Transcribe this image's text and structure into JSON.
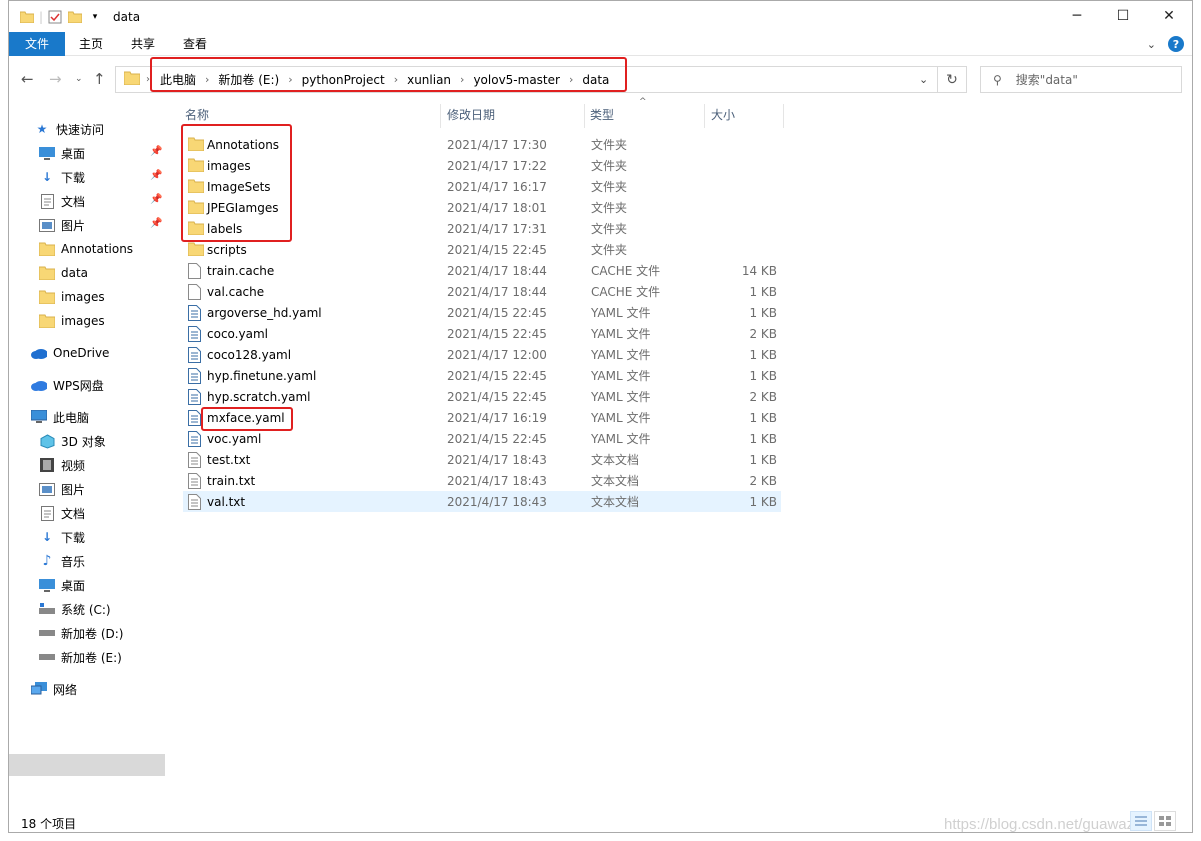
{
  "window": {
    "title": "data"
  },
  "ribbon": {
    "tabs": [
      "文件",
      "主页",
      "共享",
      "查看"
    ]
  },
  "address": {
    "crumbs": [
      "此电脑",
      "新加卷 (E:)",
      "pythonProject",
      "xunlian",
      "yolov5-master",
      "data"
    ]
  },
  "search": {
    "placeholder": "搜索\"data\""
  },
  "nav": {
    "quick_access": "快速访问",
    "pinned": [
      "桌面",
      "下载",
      "文档",
      "图片"
    ],
    "recent": [
      "Annotations",
      "data",
      "images",
      "images"
    ],
    "onedrive": "OneDrive",
    "wps": "WPS网盘",
    "this_pc": "此电脑",
    "pc_items": [
      "3D 对象",
      "视频",
      "图片",
      "文档",
      "下载",
      "音乐",
      "桌面",
      "系统 (C:)",
      "新加卷 (D:)",
      "新加卷 (E:)"
    ],
    "network": "网络"
  },
  "columns": {
    "name": "名称",
    "date": "修改日期",
    "type": "类型",
    "size": "大小"
  },
  "files": [
    {
      "name": "Annotations",
      "date": "2021/4/17 17:30",
      "type": "文件夹",
      "size": "",
      "icon": "folder-icon"
    },
    {
      "name": "images",
      "date": "2021/4/17 17:22",
      "type": "文件夹",
      "size": "",
      "icon": "folder-icon"
    },
    {
      "name": "ImageSets",
      "date": "2021/4/17 16:17",
      "type": "文件夹",
      "size": "",
      "icon": "folder-icon"
    },
    {
      "name": "JPEGIamges",
      "date": "2021/4/17 18:01",
      "type": "文件夹",
      "size": "",
      "icon": "folder-icon"
    },
    {
      "name": "labels",
      "date": "2021/4/17 17:31",
      "type": "文件夹",
      "size": "",
      "icon": "folder-icon"
    },
    {
      "name": "scripts",
      "date": "2021/4/15 22:45",
      "type": "文件夹",
      "size": "",
      "icon": "folder-icon"
    },
    {
      "name": "train.cache",
      "date": "2021/4/17 18:44",
      "type": "CACHE 文件",
      "size": "14 KB",
      "icon": "file-icon"
    },
    {
      "name": "val.cache",
      "date": "2021/4/17 18:44",
      "type": "CACHE 文件",
      "size": "1 KB",
      "icon": "file-icon"
    },
    {
      "name": "argoverse_hd.yaml",
      "date": "2021/4/15 22:45",
      "type": "YAML 文件",
      "size": "1 KB",
      "icon": "yaml-icon"
    },
    {
      "name": "coco.yaml",
      "date": "2021/4/15 22:45",
      "type": "YAML 文件",
      "size": "2 KB",
      "icon": "yaml-icon"
    },
    {
      "name": "coco128.yaml",
      "date": "2021/4/17 12:00",
      "type": "YAML 文件",
      "size": "1 KB",
      "icon": "yaml-icon"
    },
    {
      "name": "hyp.finetune.yaml",
      "date": "2021/4/15 22:45",
      "type": "YAML 文件",
      "size": "1 KB",
      "icon": "yaml-icon"
    },
    {
      "name": "hyp.scratch.yaml",
      "date": "2021/4/15 22:45",
      "type": "YAML 文件",
      "size": "2 KB",
      "icon": "yaml-icon"
    },
    {
      "name": "mxface.yaml",
      "date": "2021/4/17 16:19",
      "type": "YAML 文件",
      "size": "1 KB",
      "icon": "yaml-icon"
    },
    {
      "name": "voc.yaml",
      "date": "2021/4/15 22:45",
      "type": "YAML 文件",
      "size": "1 KB",
      "icon": "yaml-icon"
    },
    {
      "name": "test.txt",
      "date": "2021/4/17 18:43",
      "type": "文本文档",
      "size": "1 KB",
      "icon": "text-file-icon"
    },
    {
      "name": "train.txt",
      "date": "2021/4/17 18:43",
      "type": "文本文档",
      "size": "2 KB",
      "icon": "text-file-icon"
    },
    {
      "name": "val.txt",
      "date": "2021/4/17 18:43",
      "type": "文本文档",
      "size": "1 KB",
      "icon": "text-file-icon"
    }
  ],
  "status": {
    "count": "18 个项目"
  },
  "watermark": "https://blog.csdn.net/guawazi",
  "colors": {
    "accent": "#1979ca",
    "highlight": "#e02020",
    "folder": "#f8d775",
    "selection": "#e5f3ff"
  }
}
